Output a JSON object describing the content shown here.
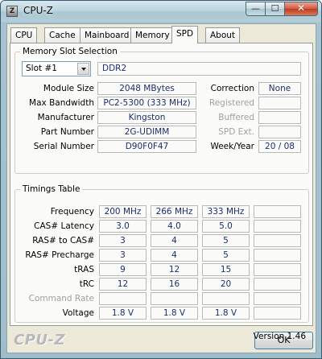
{
  "window": {
    "title": "CPU-Z",
    "app_icon_glyph": "Z",
    "min_glyph": "—",
    "max_glyph": "☐",
    "close_glyph": "✕"
  },
  "tabs": [
    {
      "label": "CPU",
      "active": false
    },
    {
      "label": "Cache",
      "active": false
    },
    {
      "label": "Mainboard",
      "active": false
    },
    {
      "label": "Memory",
      "active": false
    },
    {
      "label": "SPD",
      "active": true
    },
    {
      "label": "About",
      "active": false
    }
  ],
  "memory_slot": {
    "legend": "Memory Slot Selection",
    "slot_selected": "Slot #1",
    "memory_type": "DDR2",
    "fields": {
      "module_size": {
        "label": "Module Size",
        "value": "2048 MBytes"
      },
      "max_bandwidth": {
        "label": "Max Bandwidth",
        "value": "PC2-5300 (333 MHz)"
      },
      "manufacturer": {
        "label": "Manufacturer",
        "value": "Kingston"
      },
      "part_number": {
        "label": "Part Number",
        "value": "2G-UDIMM"
      },
      "serial_number": {
        "label": "Serial Number",
        "value": "D90F0F47"
      }
    },
    "right_fields": {
      "correction": {
        "label": "Correction",
        "value": "None"
      },
      "registered": {
        "label": "Registered",
        "value": ""
      },
      "buffered": {
        "label": "Buffered",
        "value": ""
      },
      "spd_ext": {
        "label": "SPD Ext.",
        "value": ""
      },
      "week_year": {
        "label": "Week/Year",
        "value": "20 / 08"
      }
    }
  },
  "timings": {
    "legend": "Timings Table",
    "rows": [
      {
        "label": "Frequency",
        "enabled": true,
        "values": [
          "200 MHz",
          "266 MHz",
          "333 MHz",
          ""
        ]
      },
      {
        "label": "CAS# Latency",
        "enabled": true,
        "values": [
          "3.0",
          "4.0",
          "5.0",
          ""
        ]
      },
      {
        "label": "RAS# to CAS#",
        "enabled": true,
        "values": [
          "3",
          "4",
          "5",
          ""
        ]
      },
      {
        "label": "RAS# Precharge",
        "enabled": true,
        "values": [
          "3",
          "4",
          "5",
          ""
        ]
      },
      {
        "label": "tRAS",
        "enabled": true,
        "values": [
          "9",
          "12",
          "15",
          ""
        ]
      },
      {
        "label": "tRC",
        "enabled": true,
        "values": [
          "12",
          "16",
          "20",
          ""
        ]
      },
      {
        "label": "Command Rate",
        "enabled": false,
        "values": [
          "",
          "",
          "",
          ""
        ]
      },
      {
        "label": "Voltage",
        "enabled": true,
        "values": [
          "1.8 V",
          "1.8 V",
          "1.8 V",
          ""
        ]
      }
    ]
  },
  "footer": {
    "version": "Version 1.46",
    "logo": "CPU-Z",
    "ok_label": "OK"
  }
}
